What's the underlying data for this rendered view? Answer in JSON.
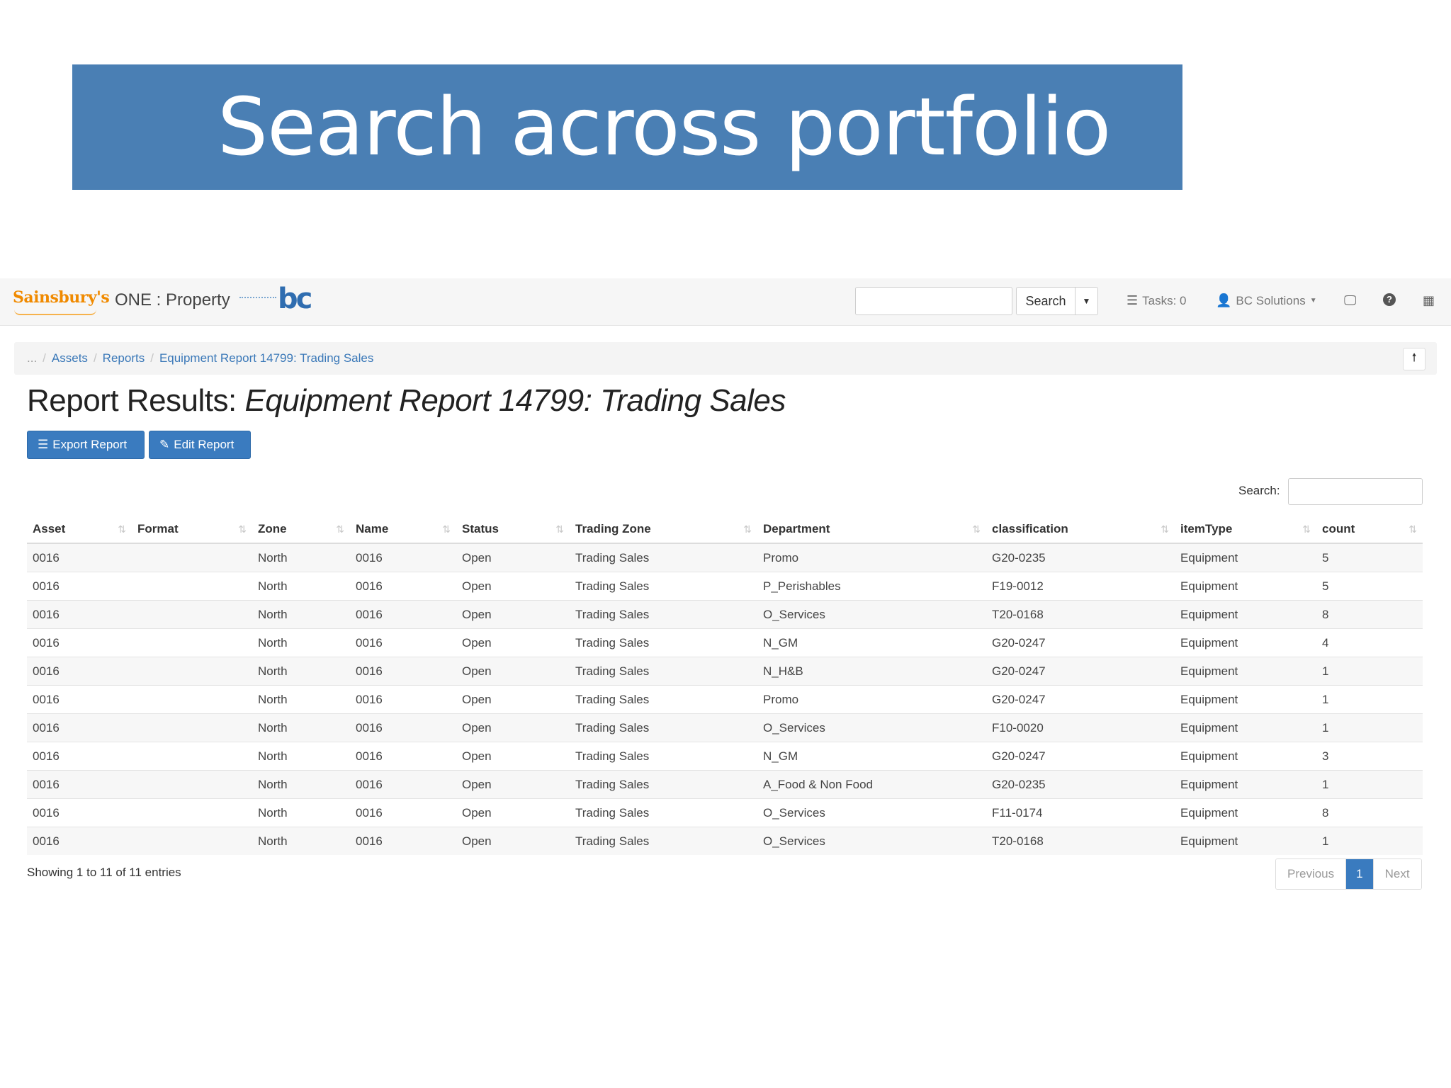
{
  "slide": {
    "title": "Search across portfolio"
  },
  "navbar": {
    "brand": "Sainsbury's",
    "app_name": "ONE : Property",
    "bc_logo": "bc",
    "search_button": "Search",
    "tasks": "Tasks: 0",
    "user": "BC Solutions",
    "icons": {
      "tasks": "list-icon",
      "user": "user-icon",
      "monitor": "monitor-icon",
      "help": "help-icon",
      "apps": "grid-icon"
    }
  },
  "breadcrumb": {
    "ellipsis": "...",
    "items": [
      "Assets",
      "Reports",
      "Equipment Report 14799: Trading Sales"
    ]
  },
  "page": {
    "title_prefix": "Report Results:",
    "title_report": "Equipment Report 14799: Trading Sales",
    "export_label": "Export Report",
    "edit_label": "Edit Report",
    "search_label": "Search:"
  },
  "table": {
    "columns": [
      "Asset",
      "Format",
      "Zone",
      "Name",
      "Status",
      "Trading Zone",
      "Department",
      "classification",
      "itemType",
      "count"
    ],
    "rows": [
      [
        "0016",
        "",
        "North",
        "0016",
        "Open",
        "Trading Sales",
        "Promo",
        "G20-0235",
        "Equipment",
        "5"
      ],
      [
        "0016",
        "",
        "North",
        "0016",
        "Open",
        "Trading Sales",
        "P_Perishables",
        "F19-0012",
        "Equipment",
        "5"
      ],
      [
        "0016",
        "",
        "North",
        "0016",
        "Open",
        "Trading Sales",
        "O_Services",
        "T20-0168",
        "Equipment",
        "8"
      ],
      [
        "0016",
        "",
        "North",
        "0016",
        "Open",
        "Trading Sales",
        "N_GM",
        "G20-0247",
        "Equipment",
        "4"
      ],
      [
        "0016",
        "",
        "North",
        "0016",
        "Open",
        "Trading Sales",
        "N_H&B",
        "G20-0247",
        "Equipment",
        "1"
      ],
      [
        "0016",
        "",
        "North",
        "0016",
        "Open",
        "Trading Sales",
        "Promo",
        "G20-0247",
        "Equipment",
        "1"
      ],
      [
        "0016",
        "",
        "North",
        "0016",
        "Open",
        "Trading Sales",
        "O_Services",
        "F10-0020",
        "Equipment",
        "1"
      ],
      [
        "0016",
        "",
        "North",
        "0016",
        "Open",
        "Trading Sales",
        "N_GM",
        "G20-0247",
        "Equipment",
        "3"
      ],
      [
        "0016",
        "",
        "North",
        "0016",
        "Open",
        "Trading Sales",
        "A_Food & Non Food",
        "G20-0235",
        "Equipment",
        "1"
      ],
      [
        "0016",
        "",
        "North",
        "0016",
        "Open",
        "Trading Sales",
        "O_Services",
        "F11-0174",
        "Equipment",
        "8"
      ],
      [
        "0016",
        "",
        "North",
        "0016",
        "Open",
        "Trading Sales",
        "O_Services",
        "T20-0168",
        "Equipment",
        "1"
      ]
    ],
    "showing": "Showing 1 to 11 of 11 entries"
  },
  "pagination": {
    "previous": "Previous",
    "current": "1",
    "next": "Next"
  },
  "colors": {
    "banner": "#4a7fb4",
    "primary": "#3a7bbf",
    "brand": "#f08a00",
    "link": "#3a78b8"
  }
}
